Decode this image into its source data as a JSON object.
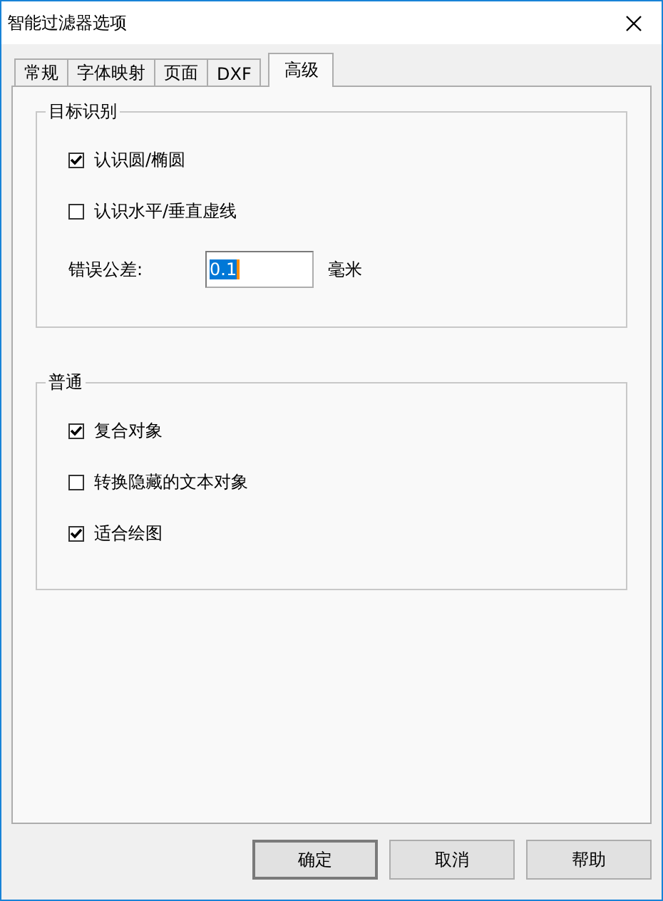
{
  "window": {
    "title": "智能过滤器选项"
  },
  "tabs": [
    {
      "label": "常规",
      "selected": false
    },
    {
      "label": "字体映射",
      "selected": false
    },
    {
      "label": "页面",
      "selected": false
    },
    {
      "label": "DXF",
      "selected": false
    },
    {
      "label": "高级",
      "selected": true
    }
  ],
  "groups": [
    {
      "title": "目标识别",
      "items": [
        {
          "kind": "checkbox",
          "label": "认识圆/椭圆",
          "checked": true
        },
        {
          "kind": "checkbox",
          "label": "认识水平/垂直虚线",
          "checked": false
        },
        {
          "kind": "field",
          "label": "错误公差:",
          "value": "0.1",
          "unit": "毫米"
        }
      ]
    },
    {
      "title": "普通",
      "items": [
        {
          "kind": "checkbox",
          "label": "复合对象",
          "checked": true
        },
        {
          "kind": "checkbox",
          "label": "转换隐藏的文本对象",
          "checked": false
        },
        {
          "kind": "checkbox",
          "label": "适合绘图",
          "checked": true
        }
      ]
    }
  ],
  "buttons": [
    "确定",
    "取消",
    "帮助"
  ]
}
